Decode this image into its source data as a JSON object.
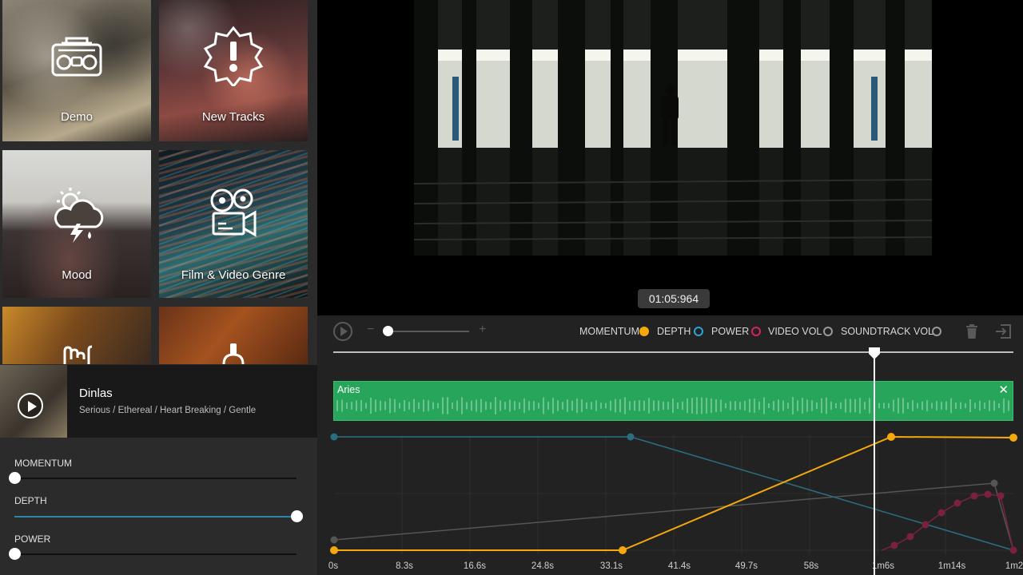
{
  "categories": [
    {
      "label": "Demo",
      "icon": "boombox-icon"
    },
    {
      "label": "New Tracks",
      "icon": "alert-badge-icon"
    },
    {
      "label": "Mood",
      "icon": "weather-storm-icon"
    },
    {
      "label": "Film & Video Genre",
      "icon": "film-camera-icon"
    },
    {
      "label": "",
      "icon": "rock-hand-icon"
    },
    {
      "label": "",
      "icon": "violin-icon"
    }
  ],
  "now_playing": {
    "title": "Dinlas",
    "tags": "Serious / Ethereal / Heart Breaking / Gentle"
  },
  "sliders": [
    {
      "label": "MOMENTUM",
      "value": 0.0,
      "color": "#111111"
    },
    {
      "label": "DEPTH",
      "value": 1.0,
      "color": "#2a86a6"
    },
    {
      "label": "POWER",
      "value": 0.0,
      "color": "#111111"
    }
  ],
  "video": {
    "timecode": "01:05:964"
  },
  "timeline": {
    "legend": [
      {
        "label": "MOMENTUM",
        "color": "#f5a90c",
        "filled": true
      },
      {
        "label": "DEPTH",
        "color": "#29a3d6",
        "filled": false
      },
      {
        "label": "POWER",
        "color": "#d6245a",
        "filled": false
      },
      {
        "label": "VIDEO VOL",
        "color": "#9a9a9a",
        "filled": false
      },
      {
        "label": "SOUNDTRACK VOL",
        "color": "#9a9a9a",
        "filled": false
      }
    ],
    "track": {
      "name": "Aries",
      "close": "✕"
    },
    "ticks": [
      "0s",
      "8.3s",
      "16.6s",
      "24.8s",
      "33.1s",
      "41.4s",
      "49.7s",
      "58s",
      "1m6s",
      "1m14s",
      "1m2"
    ],
    "playhead_fraction": 0.796
  }
}
